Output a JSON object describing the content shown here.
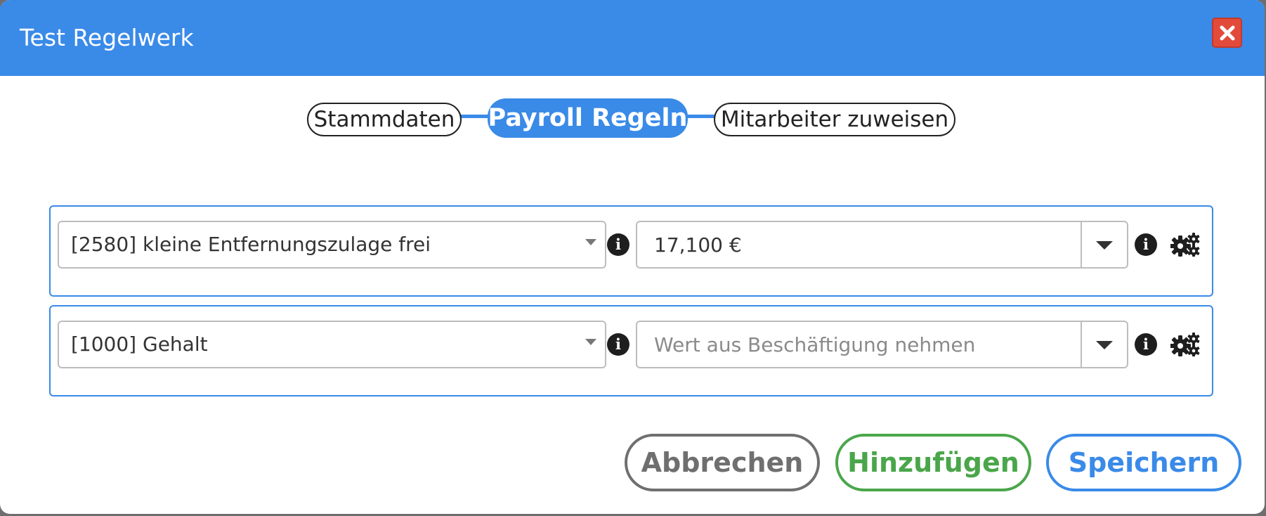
{
  "dialog": {
    "title": "Test Regelwerk",
    "close_icon": "close-icon"
  },
  "stepper": {
    "steps": [
      {
        "label": "Stammdaten",
        "active": false
      },
      {
        "label": "Payroll Regeln",
        "active": true
      },
      {
        "label": "Mitarbeiter zuweisen",
        "active": false
      }
    ]
  },
  "rules": [
    {
      "wage_type": "[2580] kleine Entfernungszulage frei",
      "value": "17,100 €",
      "value_placeholder": "",
      "info_icon": "info-icon",
      "settings_icon": "gears-icon"
    },
    {
      "wage_type": "[1000] Gehalt",
      "value": "",
      "value_placeholder": "Wert aus Beschäftigung nehmen",
      "info_icon": "info-icon",
      "settings_icon": "gears-icon"
    }
  ],
  "footer": {
    "cancel_label": "Abbrechen",
    "add_label": "Hinzufügen",
    "save_label": "Speichern"
  },
  "colors": {
    "primary": "#3a8ae8",
    "close": "#e24b3a",
    "add": "#4aa64a",
    "cancel": "#6f6f6f"
  }
}
